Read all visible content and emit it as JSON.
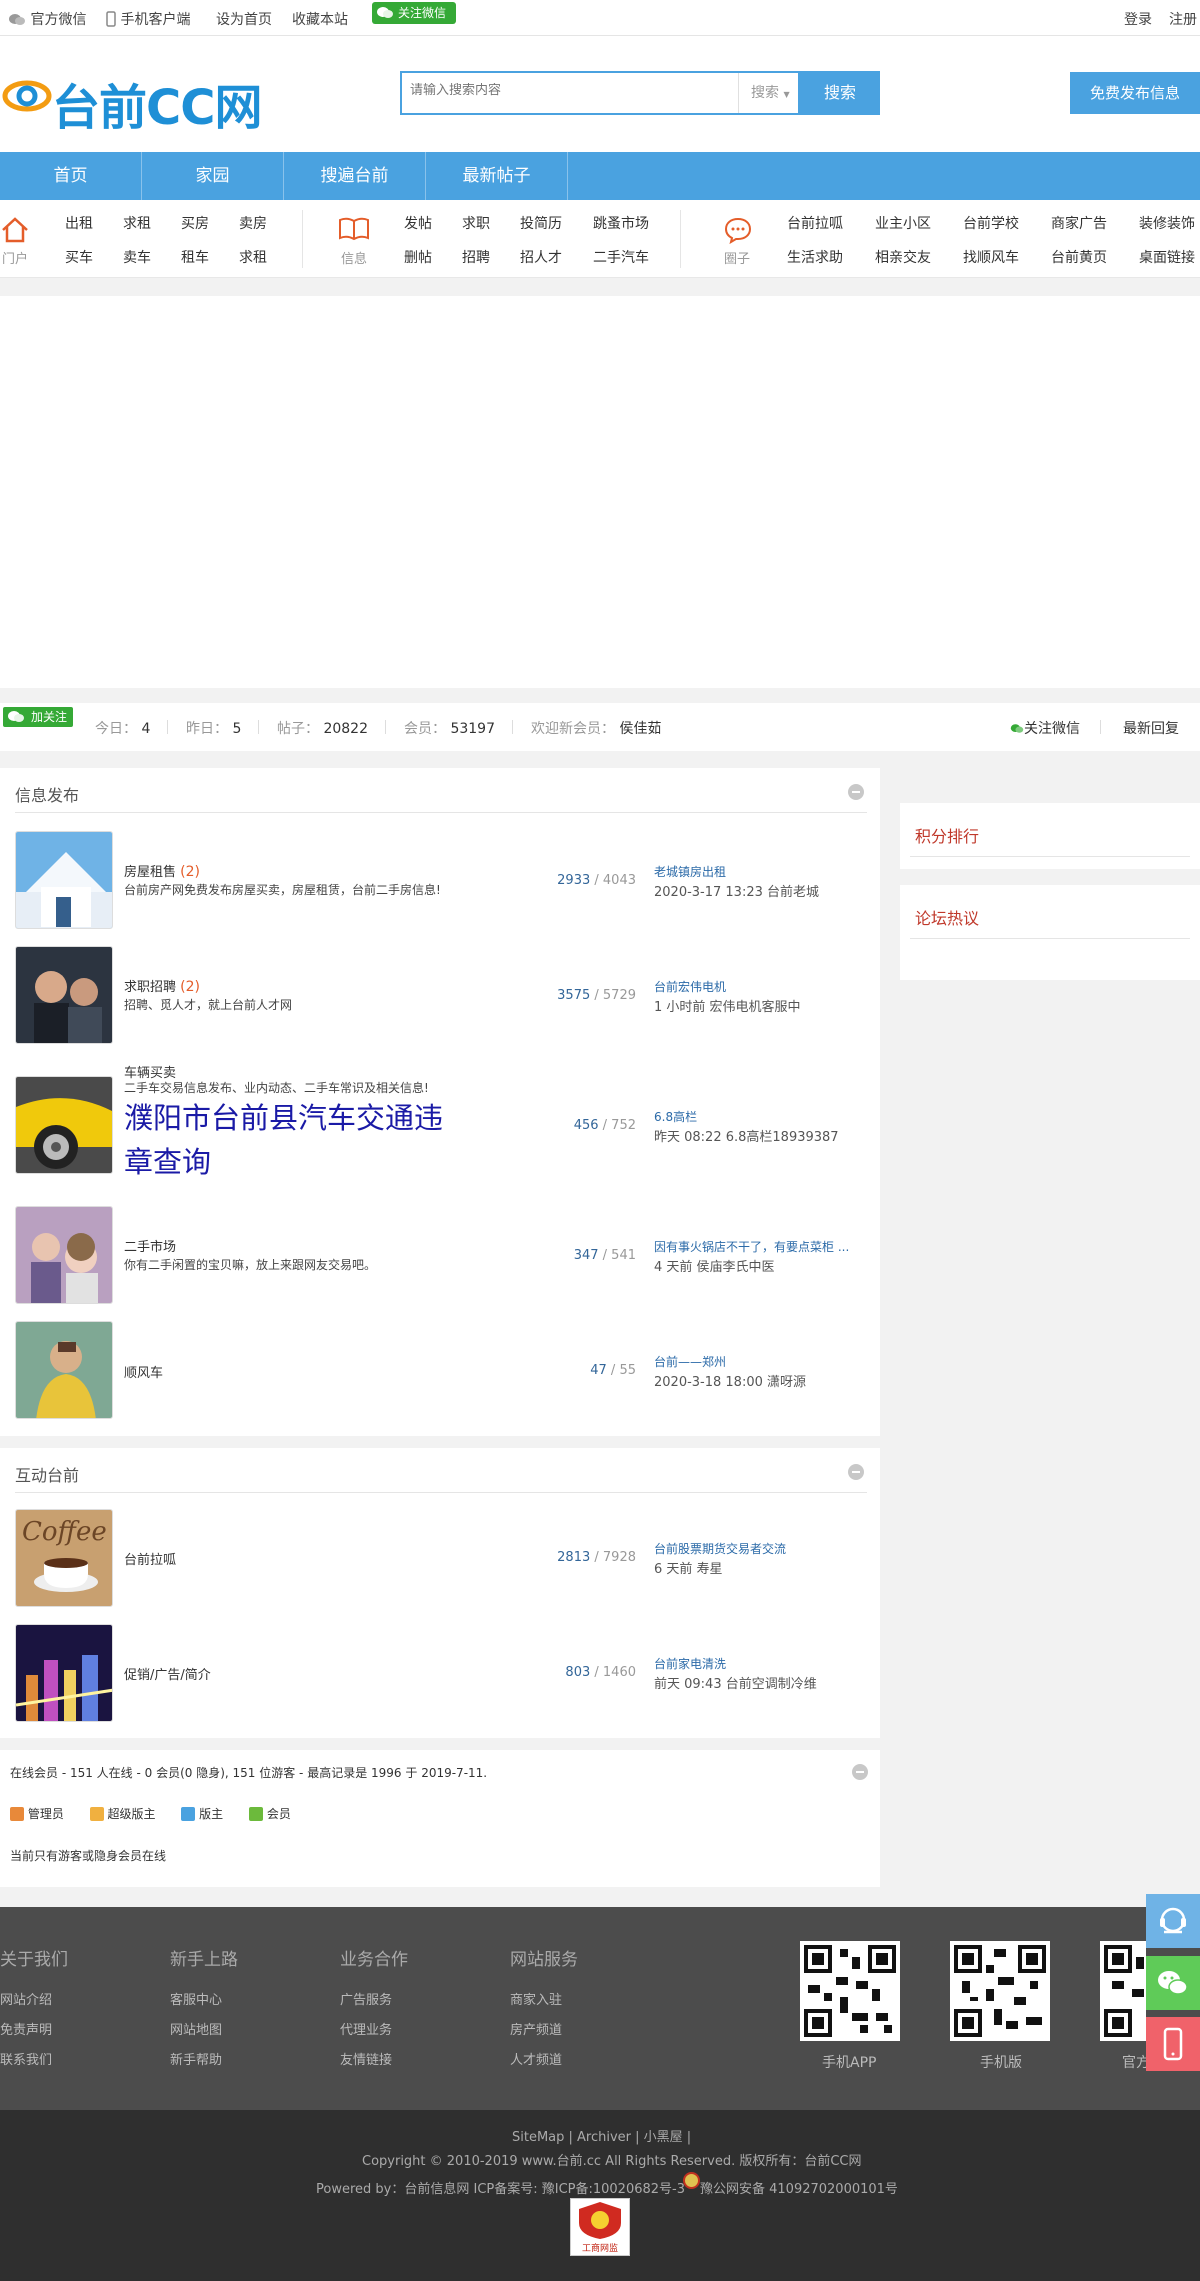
{
  "topbar": {
    "wechat": "官方微信",
    "mobile": "手机客户端",
    "set_home": "设为首页",
    "favorite": "收藏本站",
    "follow_badge": "关注微信",
    "login": "登录",
    "register": "注册"
  },
  "header": {
    "logo_text": "台前CC网",
    "search_placeholder": "请输入搜索内容",
    "search_type": "搜索",
    "search_button": "搜索",
    "post_button": "免费发布信息"
  },
  "nav": [
    "首页",
    "家园",
    "搜遍台前",
    "最新帖子"
  ],
  "subnav": {
    "portal": {
      "label": "门户",
      "links": [
        "出租",
        "求租",
        "买房",
        "卖房",
        "买车",
        "卖车",
        "租车",
        "求租"
      ]
    },
    "info": {
      "label": "信息",
      "links": [
        "发帖",
        "求职",
        "投简历",
        "跳蚤市场",
        "删帖",
        "招聘",
        "招人才",
        "二手汽车"
      ]
    },
    "circle": {
      "label": "圈子",
      "links": [
        "台前拉呱",
        "业主小区",
        "台前学校",
        "商家广告",
        "装修装饰",
        "生活求助",
        "相亲交友",
        "找顺风车",
        "台前黄页",
        "桌面链接"
      ]
    }
  },
  "stats": {
    "follow": "加关注",
    "today_label": "今日：",
    "today": "4",
    "yesterday_label": "昨日：",
    "yesterday": "5",
    "posts_label": "帖子：",
    "posts": "20822",
    "members_label": "会员：",
    "members": "53197",
    "welcome_label": "欢迎新会员：",
    "new_member": "侯佳茹",
    "follow_wechat": "关注微信",
    "latest_reply": "最新回复"
  },
  "info_section": {
    "title": "信息发布",
    "forums": [
      {
        "name": "房屋租售",
        "count": "(2)",
        "desc": "台前房产网免费发布房屋买卖，房屋租赁，台前二手房信息!",
        "threads": "2933",
        "posts": "4043",
        "last_title": "老城镇房出租",
        "last_meta": "2020-3-17 13:23 台前老城"
      },
      {
        "name": "求职招聘",
        "count": "(2)",
        "desc": "招聘、觅人才，就上台前人才网",
        "threads": "3575",
        "posts": "5729",
        "last_title": "台前宏伟电机",
        "last_meta": "1 小时前 宏伟电机客服中"
      },
      {
        "name": "车辆买卖",
        "count": "",
        "desc": "二手车交易信息发布、业内动态、二手车常识及相关信息!",
        "ad_line1": "濮阳市台前县汽车交通违",
        "ad_line2": "章查询",
        "threads": "456",
        "posts": "752",
        "last_title": "6.8高栏",
        "last_meta": "昨天 08:22 6.8高栏18939387"
      },
      {
        "name": "二手市场",
        "count": "",
        "desc": "你有二手闲置的宝贝嘛，放上来跟网友交易吧。",
        "threads": "347",
        "posts": "541",
        "last_title": "因有事火锅店不干了，有要点菜柜 ...",
        "last_meta": "4 天前 侯庙李氏中医"
      },
      {
        "name": "顺风车",
        "count": "",
        "desc": "",
        "threads": "47",
        "posts": "55",
        "last_title": "台前——郑州",
        "last_meta": "2020-3-18 18:00 潇呀源"
      }
    ]
  },
  "interact_section": {
    "title": "互动台前",
    "forums": [
      {
        "name": "台前拉呱",
        "threads": "2813",
        "posts": "7928",
        "last_title": "台前股票期货交易者交流",
        "last_meta": "6 天前 寿星"
      },
      {
        "name": "促销/广告/简介",
        "threads": "803",
        "posts": "1460",
        "last_title": "台前家电清洗",
        "last_meta": "前天 09:43 台前空调制冷维"
      }
    ]
  },
  "online": {
    "summary": "在线会员 - 151 人在线 - 0 会员(0 隐身), 151 位游客 - 最高记录是 1996 于 2019-7-11.",
    "legend": [
      "管理员",
      "超级版主",
      "版主",
      "会员"
    ],
    "note": "当前只有游客或隐身会员在线"
  },
  "sidebar": {
    "points_rank": "积分排行",
    "forum_hot": "论坛热议"
  },
  "footer": {
    "cols": [
      {
        "title": "关于我们",
        "links": [
          "网站介绍",
          "免责声明",
          "联系我们"
        ]
      },
      {
        "title": "新手上路",
        "links": [
          "客服中心",
          "网站地图",
          "新手帮助"
        ]
      },
      {
        "title": "业务合作",
        "links": [
          "广告服务",
          "代理业务",
          "友情链接"
        ]
      },
      {
        "title": "网站服务",
        "links": [
          "商家入驻",
          "房产频道",
          "人才频道"
        ]
      }
    ],
    "qr_labels": [
      "手机APP",
      "手机版",
      "官方"
    ]
  },
  "copyright": {
    "links": "SiteMap | Archiver | 小黑屋 |",
    "line1": "Copyright © 2010-2019 www.台前.cc All Rights Reserved.   版权所有：台前CC网",
    "powered": "Powered by：台前信息网   ICP备案号: 豫ICP备:10020682号-3",
    "police": "豫公网安备 41092702000101号",
    "badge": "工商网监"
  },
  "colors": {
    "accent": "#4aa2e0",
    "red": "#e45d2a",
    "link": "#2b6aa8"
  }
}
